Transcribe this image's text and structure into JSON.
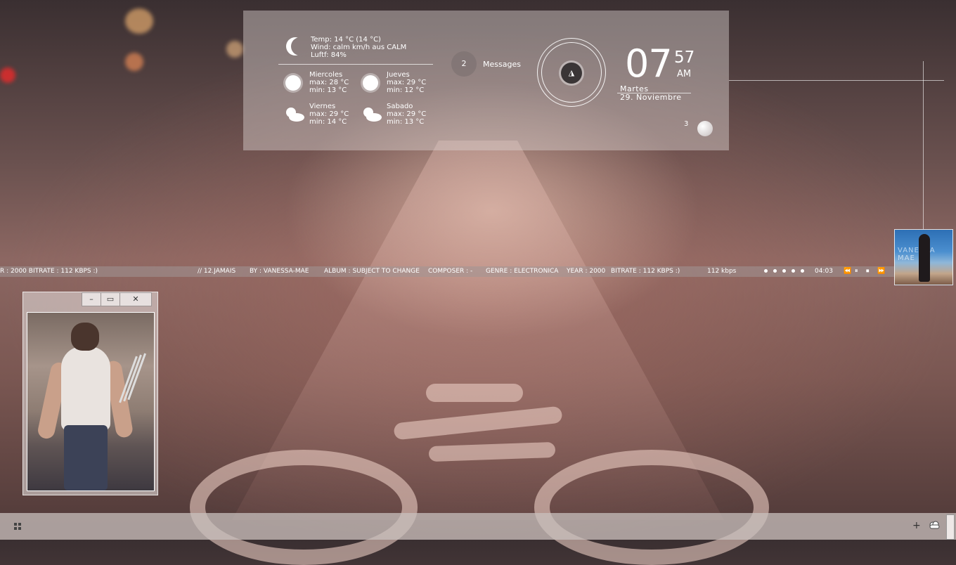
{
  "weather": {
    "temp": "Temp: 14 °C (14 °C)",
    "wind": "Wind:  calm km/h aus CALM",
    "humidity": "Luftf: 84%",
    "forecast": [
      {
        "day": "Miercoles",
        "max": "max: 28 °C",
        "min": "min:  13 °C",
        "icon": "sun-icon"
      },
      {
        "day": "Jueves",
        "max": "max: 29 °C",
        "min": "min:  12 °C",
        "icon": "sun-icon"
      },
      {
        "day": "Viernes",
        "max": "max: 29 °C",
        "min": "min:  14 °C",
        "icon": "partly-cloudy-icon"
      },
      {
        "day": "Sabado",
        "max": "max: 29 °C",
        "min": "min:  13 °C",
        "icon": "partly-cloudy-icon"
      }
    ]
  },
  "messages": {
    "count": "2",
    "label": "Messages"
  },
  "clock": {
    "hour": "07",
    "minute": "57",
    "ampm": "AM",
    "day": "Martes",
    "date": "29. Noviembre"
  },
  "mini_widget": {
    "count": "3"
  },
  "now_playing": {
    "prev_tail": "R : 2000    BITRATE :  112  KBPS  :)",
    "track": "// 12.JAMAIS",
    "artist": "BY :  VANESSA-MAE",
    "album": "ALBUM : SUBJECT TO CHANGE",
    "composer": "COMPOSER : -",
    "genre": "GENRE : ELECTRONICA",
    "year": "YEAR : 2000",
    "bitrate": "BITRATE :  112  KBPS  :)",
    "kbps": "112 kbps",
    "time": "04:03",
    "cover_text": "VANESSA MAE"
  },
  "controls": {
    "prev": "⏪",
    "pause": "⏸",
    "stop": "⏹",
    "next": "⏩"
  },
  "window": {
    "minimize": "–",
    "maximize": "▭",
    "close": "✕"
  },
  "taskbar": {
    "plus": "+"
  }
}
